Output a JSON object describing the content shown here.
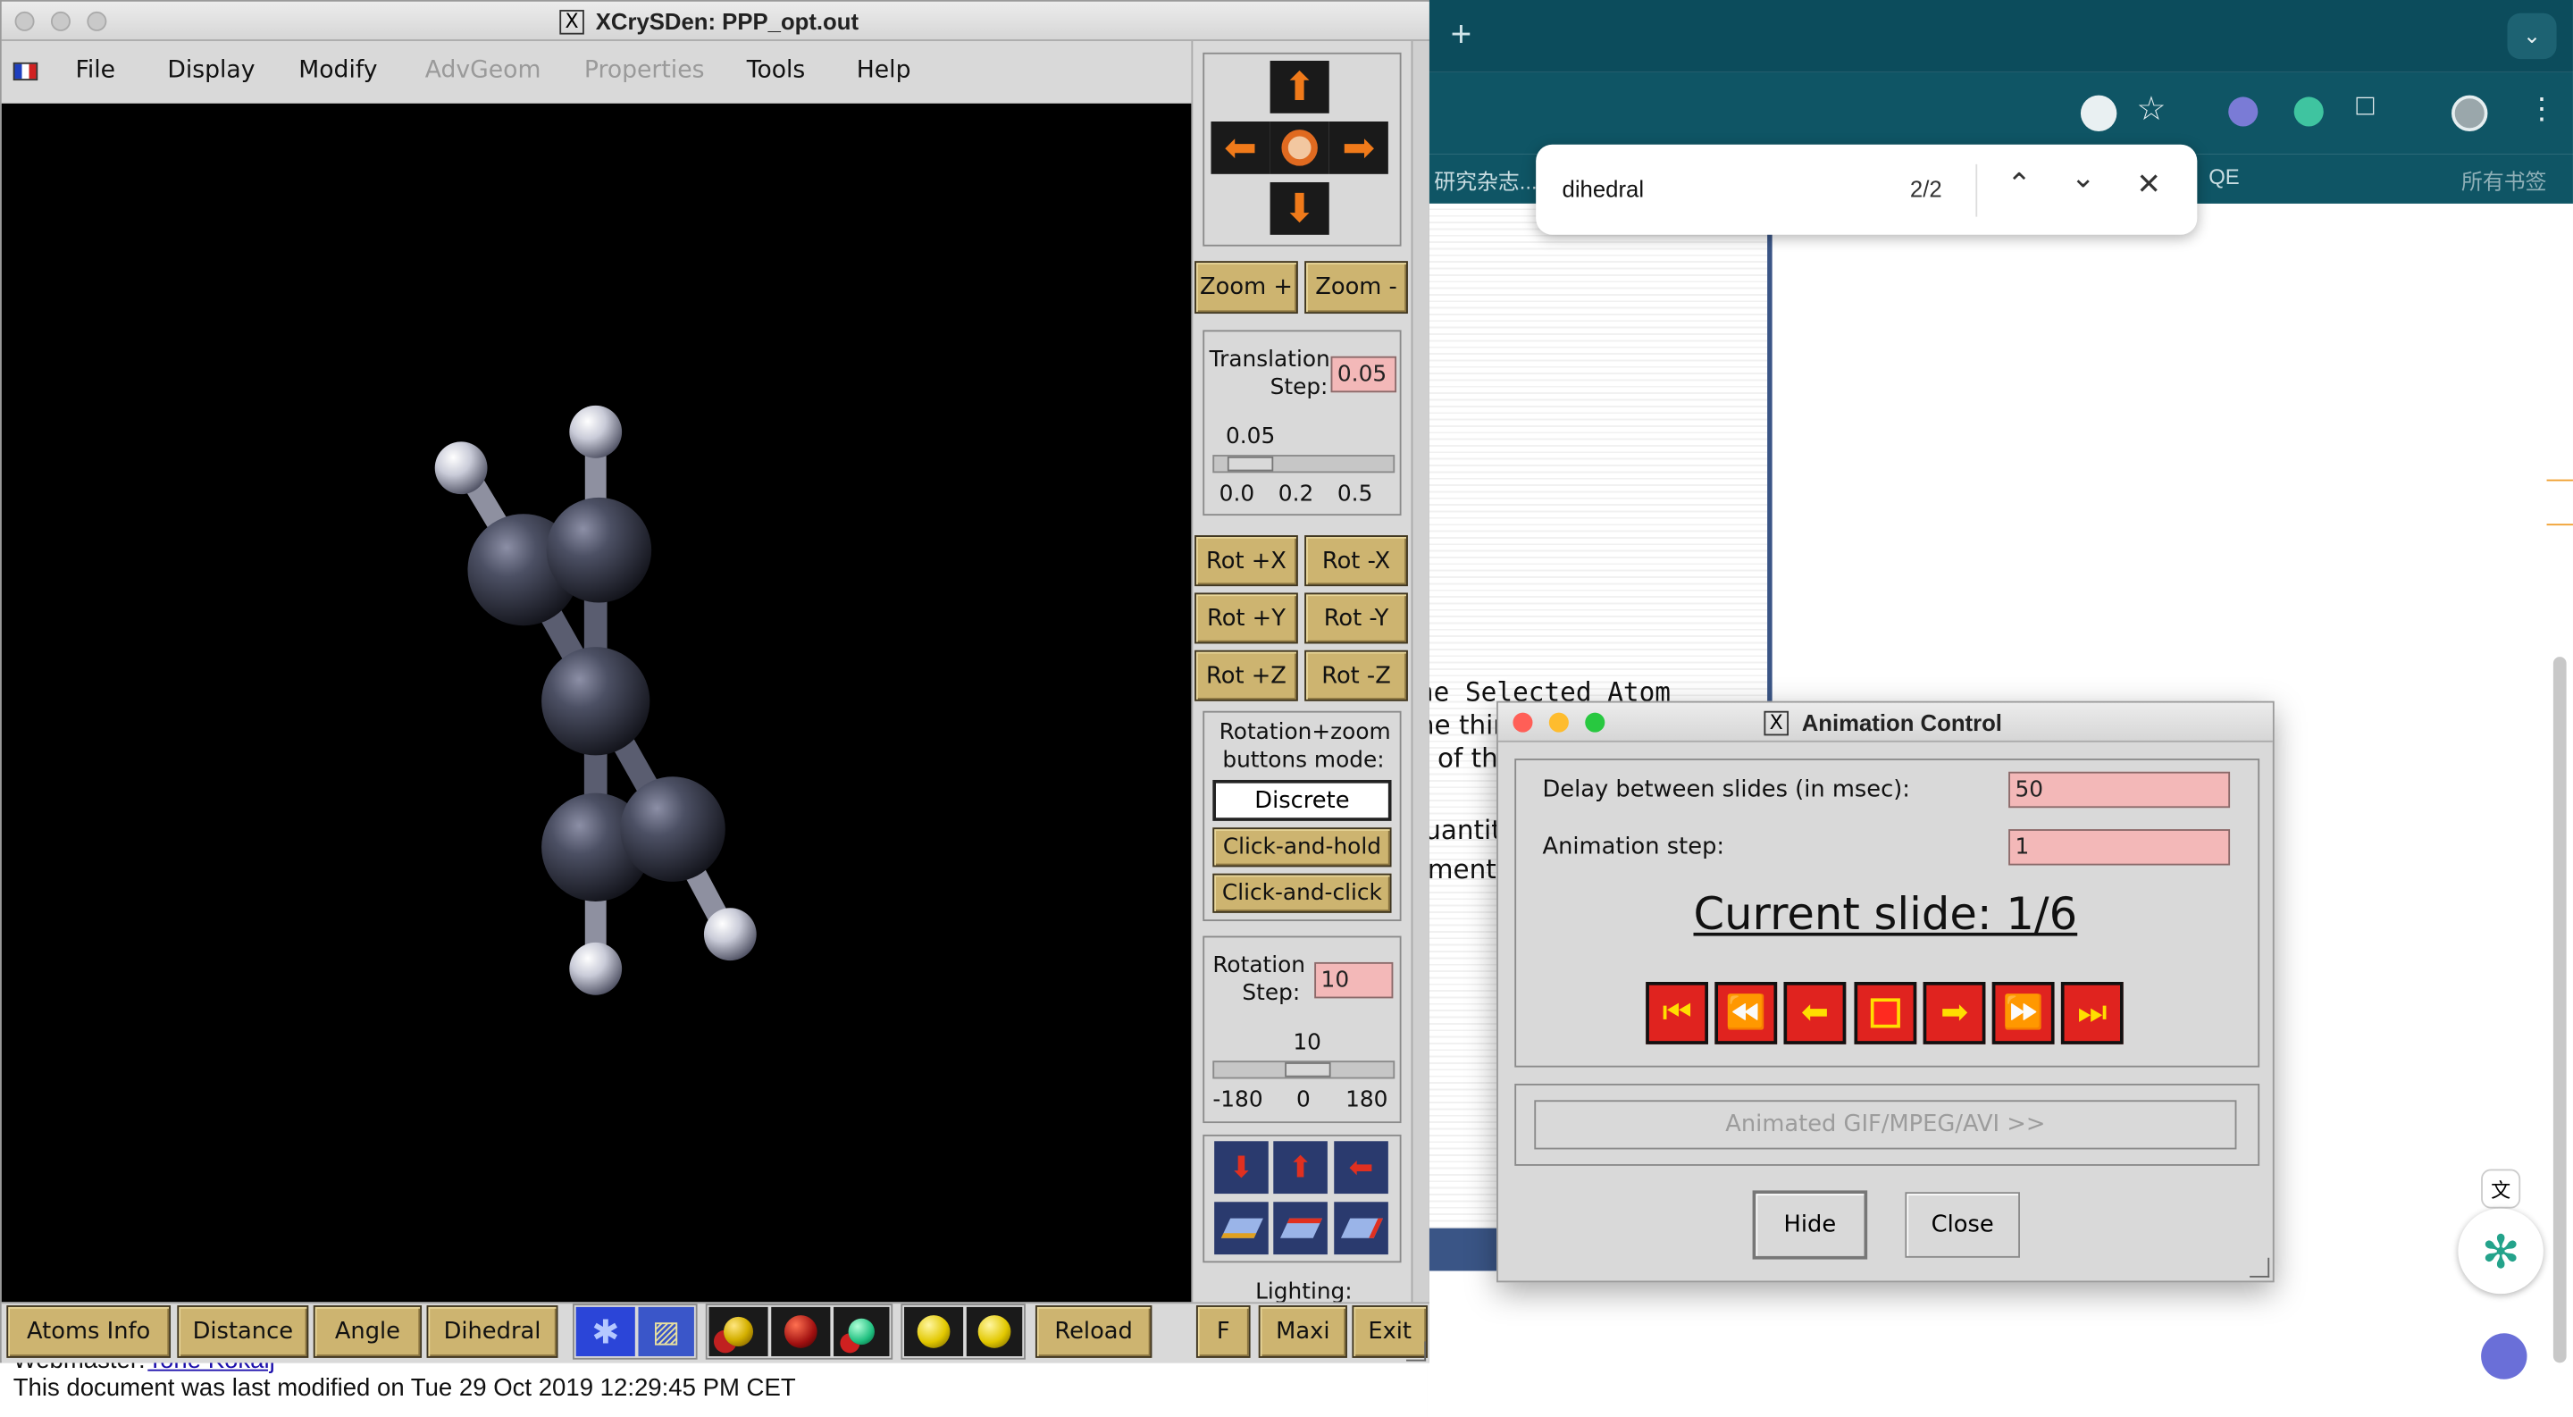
{
  "browser": {
    "new_tab": "+",
    "bookmark_left": "研究杂志...",
    "bookmark_qe": "QE",
    "bookmark_all": "所有书签",
    "find": {
      "query": "dihedral",
      "count": "2/2"
    }
  },
  "doc": {
    "line1": "he Selected Atom",
    "line2": "he thir",
    "line3": "of th",
    "line4": "uantity",
    "line5": "ment.",
    "webmaster_label": "Webmaster:",
    "webmaster_name": "Tone Kokalj",
    "modified": "This document was last modified on Tue 29 Oct 2019 12:29:45 PM CET"
  },
  "xcrysden": {
    "title": "XCrySDen: PPP_opt.out",
    "menu": {
      "file": "File",
      "display": "Display",
      "modify": "Modify",
      "advgeom": "AdvGeom",
      "properties": "Properties",
      "tools": "Tools",
      "help": "Help"
    },
    "zoom_plus": "Zoom +",
    "zoom_minus": "Zoom -",
    "translation_label_1": "Translation",
    "translation_label_2": "Step:",
    "translation_value": "0.05",
    "translation_scale_value": "0.05",
    "translation_ticks": [
      "0.0",
      "0.2",
      "0.5"
    ],
    "translation_slider_level": 0.1,
    "rot": [
      "Rot +X",
      "Rot -X",
      "Rot +Y",
      "Rot -Y",
      "Rot +Z",
      "Rot -Z"
    ],
    "mode_label_1": "Rotation+zoom",
    "mode_label_2": "buttons mode:",
    "mode_discrete": "Discrete",
    "mode_hold": "Click-and-hold",
    "mode_click": "Click-and-click",
    "rotation_label_1": "Rotation",
    "rotation_label_2": "Step:",
    "rotation_value": "10",
    "rotation_scale_value": "10",
    "rotation_ticks": [
      "-180",
      "0",
      "180"
    ],
    "rotation_slider_level": 0.53,
    "lighting": "Lighting:",
    "bottom": {
      "atoms_info": "Atoms Info",
      "distance": "Distance",
      "angle": "Angle",
      "dihedral": "Dihedral",
      "reload": "Reload",
      "f": "F",
      "maxi": "Maxi",
      "exit": "Exit"
    }
  },
  "animation": {
    "title": "Animation Control",
    "delay_label": "Delay between slides (in msec):",
    "delay_value": "50",
    "step_label": "Animation step:",
    "step_value": "1",
    "current_slide": "Current slide: 1/6",
    "gif_button": "Animated GIF/MPEG/AVI >>",
    "hide": "Hide",
    "close": "Close"
  }
}
